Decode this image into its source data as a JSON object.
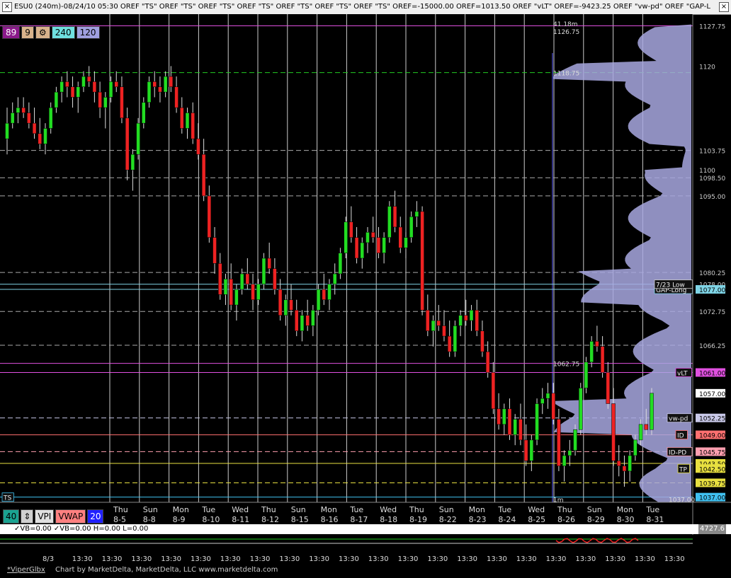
{
  "window": {
    "title": "ESU0 (240m)-08/24/10 05:30  OREF \"TS\"  OREF \"TS\"  OREF \"TS\"  OREF \"TS\"  OREF \"TS\"  OREF \"TS\"  OREF \"TS\"  OREF=-15000.00  OREF=1013.50  OREF \"vLT\"  OREF=-9423.25  OREF \"vw-pd\"  OREF \"GAP-L"
  },
  "timeframes": [
    {
      "label": "89",
      "color": "#8b1a8b",
      "text": "#ffffff"
    },
    {
      "label": "9",
      "color": "#d9b38c",
      "text": "#000000"
    },
    {
      "label": "⚙",
      "color": "#d9b38c",
      "text": "#000000"
    },
    {
      "label": "240",
      "color": "#6fe0e0",
      "text": "#000000"
    },
    {
      "label": "120",
      "color": "#a0a0e0",
      "text": "#000000"
    }
  ],
  "tools": [
    {
      "label": "40",
      "color": "#1aa391",
      "text": "#000000"
    },
    {
      "label": "⇕",
      "color": "#d0d0d0",
      "text": "#000000"
    },
    {
      "label": "VPI",
      "color": "#e0e0e0",
      "text": "#000000"
    },
    {
      "label": "VWAP",
      "color": "#ff8080",
      "text": "#000000"
    },
    {
      "label": "20",
      "color": "#2020ff",
      "text": "#ffffff"
    }
  ],
  "indicator_text": "✓VB=0.00 ✓VB=0.00 H=0.00 L=0.00",
  "indicator_value": "4727.6",
  "footer": {
    "left": "*ViperGlbx",
    "right": "Chart by MarketDelta, MarketDelta, LLC www.marketdelta.com"
  },
  "price_labels": [
    {
      "text": "1127.75",
      "price": 1127.75,
      "color": "#cccccc",
      "bg": ""
    },
    {
      "text": "1120",
      "price": 1120,
      "color": "#cccccc",
      "bg": ""
    },
    {
      "text": "1103.75",
      "price": 1103.75,
      "color": "#cccccc",
      "bg": ""
    },
    {
      "text": "1100",
      "price": 1100,
      "color": "#cccccc",
      "bg": ""
    },
    {
      "text": "1098.50",
      "price": 1098.5,
      "color": "#cccccc",
      "bg": ""
    },
    {
      "text": "1095.00",
      "price": 1095,
      "color": "#cccccc",
      "bg": ""
    },
    {
      "text": "1080.25",
      "price": 1080.25,
      "color": "#cccccc",
      "bg": ""
    },
    {
      "text": "1078.00",
      "price": 1078,
      "color": "#cccccc",
      "bg": ""
    },
    {
      "text": "1077.00",
      "price": 1077,
      "color": "#000000",
      "bg": "#7fd4e6"
    },
    {
      "text": "1072.75",
      "price": 1072.75,
      "color": "#cccccc",
      "bg": ""
    },
    {
      "text": "1066.25",
      "price": 1066.25,
      "color": "#cccccc",
      "bg": ""
    },
    {
      "text": "1061.00",
      "price": 1061,
      "color": "#000000",
      "bg": "#e050e0"
    },
    {
      "text": "1057.00",
      "price": 1057,
      "color": "#000000",
      "bg": "#ffffff"
    },
    {
      "text": "1052.25",
      "price": 1052.25,
      "color": "#000000",
      "bg": "#c8c8e8"
    },
    {
      "text": "1049.00",
      "price": 1049,
      "color": "#000000",
      "bg": "#ff7070"
    },
    {
      "text": "1045.75",
      "price": 1045.75,
      "color": "#000000",
      "bg": "#ff9fb0"
    },
    {
      "text": "1043.50",
      "price": 1043.5,
      "color": "#000000",
      "bg": "#e8e040"
    },
    {
      "text": "1042.50",
      "price": 1042.5,
      "color": "#000000",
      "bg": "#e8e040"
    },
    {
      "text": "1039.75",
      "price": 1039.75,
      "color": "#000000",
      "bg": "#e8e040"
    },
    {
      "text": "1037.00",
      "price": 1037,
      "color": "#000000",
      "bg": "#40c0f0"
    }
  ],
  "ref_labels": [
    {
      "text": "vLT",
      "price": 1061,
      "color": "#e050e0"
    },
    {
      "text": "vw-pd",
      "price": 1052.25,
      "color": "#c8c8e8"
    },
    {
      "text": "ID",
      "price": 1049,
      "color": "#ff7070"
    },
    {
      "text": "ID-PD",
      "price": 1045.75,
      "color": "#ff9fb0"
    },
    {
      "text": "GAP-Long",
      "price": 1077,
      "color": "#7fd4e6"
    },
    {
      "text": "7/23 Low",
      "price": 1078,
      "color": "#cccccc"
    },
    {
      "text": "TP",
      "price": 1042.5,
      "color": "#e8e040"
    },
    {
      "text": "TS",
      "price": 1037,
      "color": "#40c0f0"
    }
  ],
  "profile_labels": [
    {
      "text": "41.18m",
      "price": 1128.2
    },
    {
      "text": "1126.75",
      "price": 1126.75
    },
    {
      "text": "1118.75",
      "price": 1118.75
    },
    {
      "text": "1062.75",
      "price": 1062.75
    },
    {
      "text": "1m",
      "price": 1036.6
    },
    {
      "text": "1037.00",
      "price": 1036.6
    }
  ],
  "x_axis": {
    "days": [
      "Thu",
      "Sun",
      "Mon",
      "Tue",
      "Wed",
      "Thu",
      "Sun",
      "Mon",
      "Tue",
      "Wed",
      "Thu",
      "Sun",
      "Mon",
      "Tue",
      "Wed",
      "Thu",
      "Sun",
      "Mon",
      "Tue"
    ],
    "dates": [
      "8-5",
      "8-8",
      "8-9",
      "8-10",
      "8-11",
      "8-12",
      "8-15",
      "8-16",
      "8-17",
      "8-18",
      "8-19",
      "8-22",
      "8-23",
      "8-24",
      "8-25",
      "8-26",
      "8-29",
      "8-30",
      "8-31"
    ],
    "bottom": [
      "8/3",
      "13:30",
      "13:30",
      "13:30",
      "13:30",
      "13:30",
      "13:30",
      "13:30",
      "13:30",
      "13:30",
      "13:30",
      "13:30",
      "13:30",
      "13:30",
      "13:30",
      "13:30",
      "13:30",
      "13:30",
      "13:30",
      "13:30",
      "13:30",
      "13:30"
    ]
  },
  "chart_data": {
    "type": "candlestick",
    "instrument": "ESU0 (240m)",
    "ylim": [
      1036,
      1130
    ],
    "up_color": "#22dd22",
    "down_color": "#ee2222",
    "ohlc": [
      [
        1106,
        1112,
        1103,
        1109
      ],
      [
        1109,
        1113,
        1108,
        1111
      ],
      [
        1111,
        1114,
        1109,
        1112
      ],
      [
        1112,
        1114,
        1110,
        1111
      ],
      [
        1111,
        1113,
        1108,
        1109
      ],
      [
        1109,
        1112,
        1106,
        1107
      ],
      [
        1107,
        1110,
        1104,
        1105
      ],
      [
        1105,
        1109,
        1103,
        1108
      ],
      [
        1108,
        1113,
        1107,
        1112
      ],
      [
        1112,
        1116,
        1111,
        1115
      ],
      [
        1115,
        1118,
        1113,
        1117
      ],
      [
        1117,
        1119,
        1114,
        1116
      ],
      [
        1116,
        1118,
        1112,
        1114
      ],
      [
        1114,
        1117,
        1111,
        1116
      ],
      [
        1116,
        1119,
        1115,
        1118
      ],
      [
        1118,
        1120,
        1116,
        1117
      ],
      [
        1117,
        1119,
        1113,
        1115
      ],
      [
        1115,
        1117,
        1110,
        1112
      ],
      [
        1112,
        1115,
        1108,
        1114
      ],
      [
        1114,
        1118,
        1113,
        1117
      ],
      [
        1117,
        1119,
        1115,
        1116
      ],
      [
        1116,
        1118,
        1109,
        1110
      ],
      [
        1110,
        1112,
        1098,
        1100
      ],
      [
        1100,
        1104,
        1096,
        1103
      ],
      [
        1103,
        1110,
        1102,
        1109
      ],
      [
        1109,
        1114,
        1108,
        1113
      ],
      [
        1113,
        1118,
        1112,
        1117
      ],
      [
        1117,
        1119,
        1114,
        1116
      ],
      [
        1116,
        1118,
        1113,
        1115
      ],
      [
        1115,
        1119,
        1114,
        1118
      ],
      [
        1118,
        1120,
        1115,
        1116
      ],
      [
        1116,
        1118,
        1111,
        1112
      ],
      [
        1112,
        1114,
        1107,
        1108
      ],
      [
        1108,
        1112,
        1106,
        1111
      ],
      [
        1111,
        1113,
        1105,
        1106
      ],
      [
        1106,
        1109,
        1102,
        1103
      ],
      [
        1103,
        1106,
        1094,
        1095
      ],
      [
        1095,
        1097,
        1086,
        1087
      ],
      [
        1087,
        1089,
        1080,
        1082
      ],
      [
        1082,
        1084,
        1075,
        1076
      ],
      [
        1076,
        1080,
        1074,
        1079
      ],
      [
        1079,
        1082,
        1073,
        1074
      ],
      [
        1074,
        1078,
        1071,
        1077
      ],
      [
        1077,
        1081,
        1076,
        1080
      ],
      [
        1080,
        1083,
        1077,
        1078
      ],
      [
        1078,
        1080,
        1073,
        1075
      ],
      [
        1075,
        1079,
        1074,
        1078
      ],
      [
        1078,
        1084,
        1077,
        1083
      ],
      [
        1083,
        1086,
        1080,
        1081
      ],
      [
        1081,
        1083,
        1076,
        1077
      ],
      [
        1077,
        1079,
        1071,
        1072
      ],
      [
        1072,
        1076,
        1070,
        1075
      ],
      [
        1075,
        1078,
        1072,
        1073
      ],
      [
        1073,
        1075,
        1068,
        1069
      ],
      [
        1069,
        1073,
        1067,
        1072
      ],
      [
        1072,
        1075,
        1069,
        1070
      ],
      [
        1070,
        1074,
        1068,
        1073
      ],
      [
        1073,
        1078,
        1072,
        1077
      ],
      [
        1077,
        1080,
        1074,
        1075
      ],
      [
        1075,
        1079,
        1073,
        1078
      ],
      [
        1078,
        1082,
        1076,
        1080
      ],
      [
        1080,
        1085,
        1079,
        1084
      ],
      [
        1084,
        1091,
        1083,
        1090
      ],
      [
        1090,
        1093,
        1086,
        1087
      ],
      [
        1087,
        1089,
        1082,
        1083
      ],
      [
        1083,
        1087,
        1081,
        1086
      ],
      [
        1086,
        1089,
        1084,
        1088
      ],
      [
        1088,
        1091,
        1086,
        1087
      ],
      [
        1087,
        1089,
        1083,
        1084
      ],
      [
        1084,
        1088,
        1082,
        1087
      ],
      [
        1087,
        1094,
        1086,
        1093
      ],
      [
        1093,
        1096,
        1088,
        1089
      ],
      [
        1089,
        1091,
        1084,
        1085
      ],
      [
        1085,
        1088,
        1083,
        1087
      ],
      [
        1087,
        1092,
        1086,
        1091
      ],
      [
        1091,
        1094,
        1089,
        1092
      ],
      [
        1092,
        1093,
        1072,
        1073
      ],
      [
        1073,
        1076,
        1068,
        1069
      ],
      [
        1069,
        1072,
        1066,
        1071
      ],
      [
        1071,
        1074,
        1069,
        1070
      ],
      [
        1070,
        1073,
        1067,
        1068
      ],
      [
        1068,
        1071,
        1064,
        1065
      ],
      [
        1065,
        1071,
        1064,
        1070
      ],
      [
        1070,
        1073,
        1068,
        1072
      ],
      [
        1072,
        1075,
        1070,
        1071
      ],
      [
        1071,
        1074,
        1069,
        1073
      ],
      [
        1073,
        1075,
        1068,
        1069
      ],
      [
        1069,
        1071,
        1064,
        1065
      ],
      [
        1065,
        1067,
        1060,
        1061
      ],
      [
        1061,
        1063,
        1053,
        1054
      ],
      [
        1054,
        1057,
        1050,
        1051
      ],
      [
        1051,
        1055,
        1049,
        1054
      ],
      [
        1054,
        1056,
        1048,
        1049
      ],
      [
        1049,
        1053,
        1047,
        1052
      ],
      [
        1052,
        1055,
        1047,
        1048
      ],
      [
        1048,
        1051,
        1043,
        1044
      ],
      [
        1044,
        1049,
        1042,
        1048
      ],
      [
        1048,
        1056,
        1047,
        1055
      ],
      [
        1055,
        1058,
        1053,
        1056
      ],
      [
        1056,
        1059,
        1054,
        1057
      ],
      [
        1057,
        1059,
        1051,
        1052
      ],
      [
        1052,
        1054,
        1042,
        1043
      ],
      [
        1043,
        1046,
        1040,
        1045
      ],
      [
        1045,
        1048,
        1043,
        1046
      ],
      [
        1046,
        1051,
        1045,
        1050
      ],
      [
        1050,
        1059,
        1049,
        1058
      ],
      [
        1058,
        1064,
        1057,
        1063
      ],
      [
        1063,
        1068,
        1062,
        1067
      ],
      [
        1067,
        1070,
        1065,
        1066
      ],
      [
        1066,
        1068,
        1060,
        1061
      ],
      [
        1061,
        1063,
        1054,
        1055
      ],
      [
        1055,
        1058,
        1043,
        1044
      ],
      [
        1044,
        1047,
        1041,
        1043
      ],
      [
        1043,
        1045,
        1039,
        1042
      ],
      [
        1042,
        1046,
        1040,
        1045
      ],
      [
        1045,
        1049,
        1044,
        1048
      ],
      [
        1048,
        1052,
        1047,
        1051
      ],
      [
        1051,
        1054,
        1049,
        1050
      ],
      [
        1050,
        1058,
        1049,
        1057
      ]
    ],
    "horizontal_levels": [
      {
        "price": 1127.75,
        "color": "#e050e0",
        "style": "solid"
      },
      {
        "price": 1118.75,
        "color": "#22cc22",
        "style": "dashed"
      },
      {
        "price": 1103.75,
        "color": "#aaaaaa",
        "style": "dashed"
      },
      {
        "price": 1098.5,
        "color": "#aaaaaa",
        "style": "dashed"
      },
      {
        "price": 1095,
        "color": "#aaaaaa",
        "style": "dashed"
      },
      {
        "price": 1080.25,
        "color": "#aaaaaa",
        "style": "dashed"
      },
      {
        "price": 1078,
        "color": "#7fd4e6",
        "style": "solid"
      },
      {
        "price": 1077,
        "color": "#7fd4e6",
        "style": "solid"
      },
      {
        "price": 1072.75,
        "color": "#aaaaaa",
        "style": "dashed"
      },
      {
        "price": 1066.25,
        "color": "#aaaaaa",
        "style": "dashed"
      },
      {
        "price": 1062.75,
        "color": "#e050e0",
        "style": "solid"
      },
      {
        "price": 1061,
        "color": "#e050e0",
        "style": "solid"
      },
      {
        "price": 1052.25,
        "color": "#c8c8e8",
        "style": "dashed"
      },
      {
        "price": 1049,
        "color": "#ff7070",
        "style": "solid"
      },
      {
        "price": 1045.75,
        "color": "#ff9fb0",
        "style": "dashed"
      },
      {
        "price": 1043.5,
        "color": "#e8e040",
        "style": "solid"
      },
      {
        "price": 1039.75,
        "color": "#e8e040",
        "style": "dashed"
      },
      {
        "price": 1037,
        "color": "#40c0f0",
        "style": "solid"
      }
    ]
  }
}
